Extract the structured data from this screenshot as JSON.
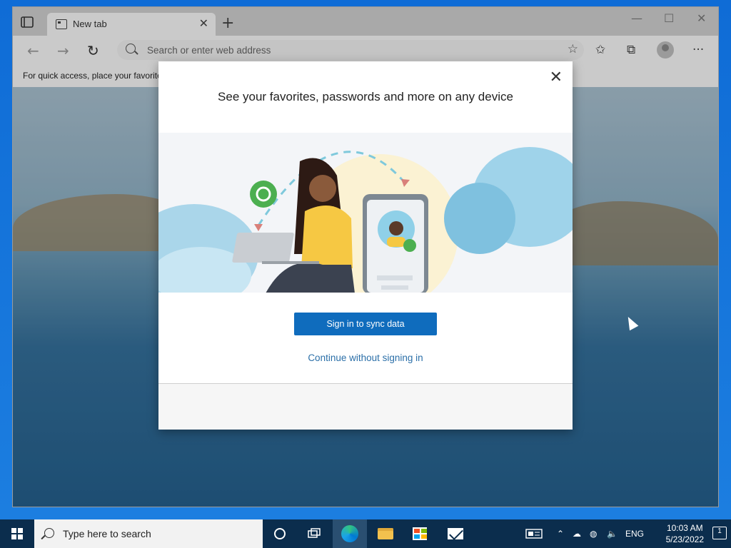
{
  "browser": {
    "tab_title": "New tab",
    "address_placeholder": "Search or enter web address",
    "favorites_bar_text": "For quick access, place your favorites here on the favorites bar. Manage favorites now"
  },
  "dialog": {
    "heading": "See your favorites, passwords and more on any device",
    "primary_button": "Sign in to sync data",
    "secondary_link": "Continue without signing in"
  },
  "taskbar": {
    "search_placeholder": "Type here to search",
    "language": "ENG",
    "time": "10:03 AM",
    "date": "5/23/2022",
    "notification_count": "1"
  },
  "icons": [
    "tab-actions-icon",
    "new-tab-icon",
    "minimize-icon",
    "maximize-icon",
    "close-window-icon",
    "back-icon",
    "forward-icon",
    "refresh-icon",
    "search-icon",
    "favorite-add-icon",
    "favorites-icon",
    "collections-icon",
    "profile-icon",
    "more-icon",
    "close-dialog-icon",
    "windows-start-icon",
    "task-view-icon",
    "cortana-icon",
    "edge-icon",
    "file-explorer-icon",
    "store-icon",
    "mail-icon",
    "news-icon",
    "chevron-up-icon",
    "onedrive-icon",
    "network-icon",
    "volume-icon",
    "notification-icon"
  ],
  "colors": {
    "primary_button": "#0f6cbd",
    "link": "#2b6fa8",
    "taskbar": "#0b2d4d",
    "desktop": "#1a73c9"
  }
}
